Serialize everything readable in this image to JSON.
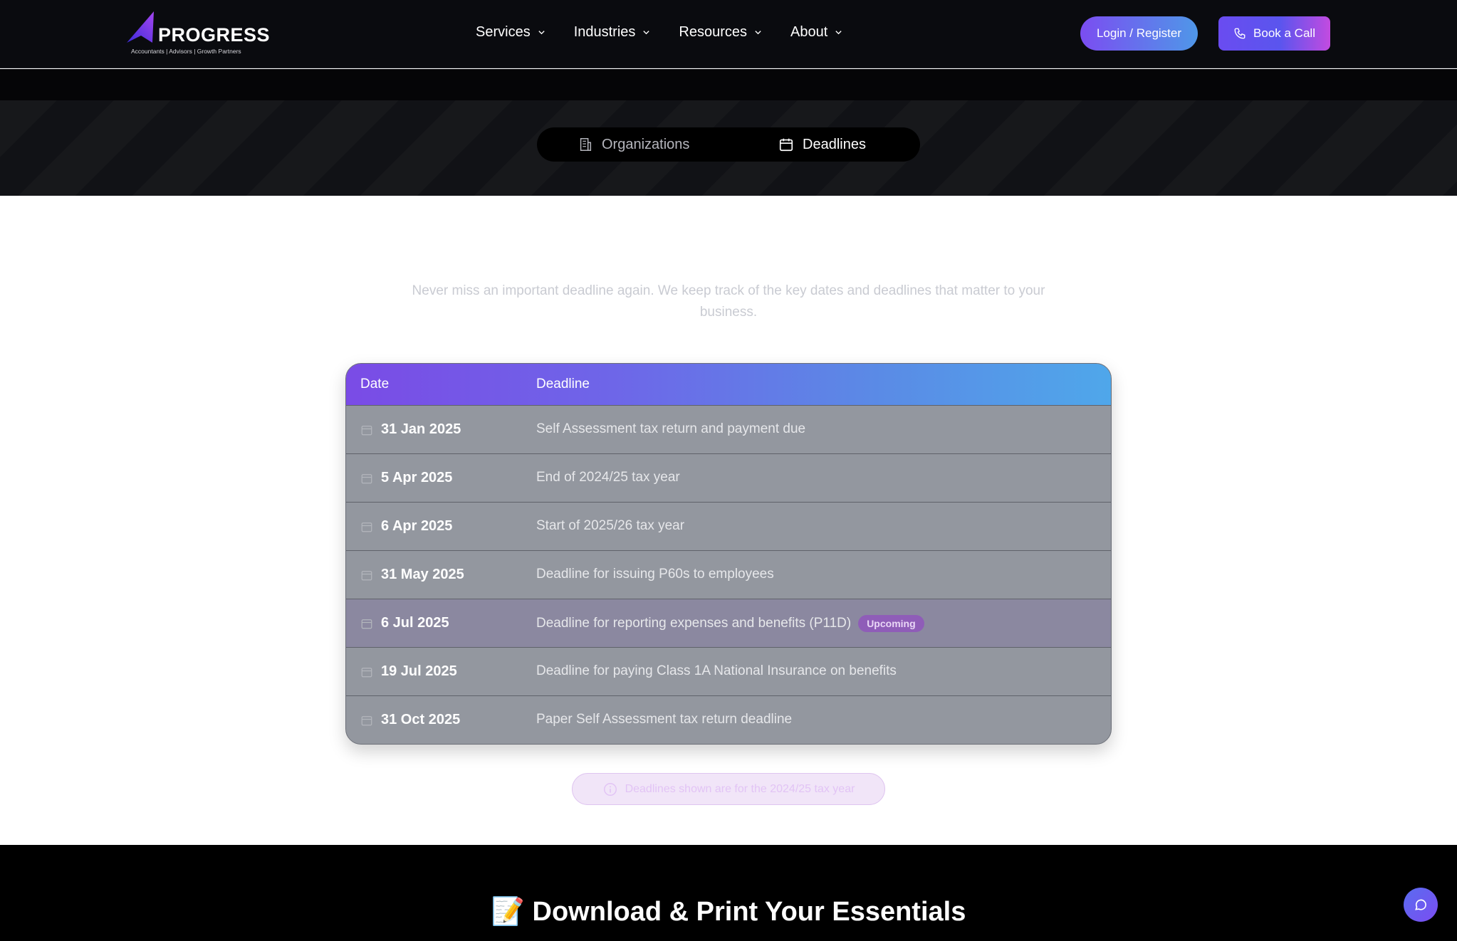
{
  "brand": {
    "name": "PROGRESS",
    "tagline": "Accountants | Advisors | Growth Partners",
    "icon": "triangle-logo-icon"
  },
  "nav": {
    "items": [
      {
        "label": "Services",
        "icon": "chevron-down-icon"
      },
      {
        "label": "Industries",
        "icon": "chevron-down-icon"
      },
      {
        "label": "Resources",
        "icon": "chevron-down-icon"
      },
      {
        "label": "About",
        "icon": "chevron-down-icon"
      }
    ],
    "login_label": "Login / Register",
    "call_label": "Book a Call",
    "call_icon": "phone-icon"
  },
  "tabs": [
    {
      "label": "Organizations",
      "icon": "building-icon",
      "active": false
    },
    {
      "label": "Deadlines",
      "icon": "calendar-icon",
      "active": true
    }
  ],
  "intro": "Never miss an important deadline again. We keep track of the key dates and deadlines that matter to your business.",
  "table": {
    "headers": {
      "date": "Date",
      "deadline": "Deadline"
    },
    "rows": [
      {
        "date": "31 Jan 2025",
        "deadline": "Self Assessment tax return and payment due",
        "badge": ""
      },
      {
        "date": "5 Apr 2025",
        "deadline": "End of 2024/25 tax year",
        "badge": ""
      },
      {
        "date": "6 Apr 2025",
        "deadline": "Start of 2025/26 tax year",
        "badge": ""
      },
      {
        "date": "31 May 2025",
        "deadline": "Deadline for issuing P60s to employees",
        "badge": ""
      },
      {
        "date": "6 Jul 2025",
        "deadline": "Deadline for reporting expenses and benefits (P11D)",
        "badge": "Upcoming"
      },
      {
        "date": "19 Jul 2025",
        "deadline": "Deadline for paying Class 1A National Insurance on benefits",
        "badge": ""
      },
      {
        "date": "31 Oct 2025",
        "deadline": "Paper Self Assessment tax return deadline",
        "badge": ""
      }
    ]
  },
  "note": {
    "text": "Deadlines shown are for the 2024/25 tax year",
    "icon": "info-icon"
  },
  "download": {
    "emoji": "📝",
    "title": "Download & Print Your Essentials"
  },
  "chat": {
    "icon": "chat-bubble-icon"
  },
  "colors": {
    "accent_purple": "#7b4df1",
    "accent_blue": "#4fa7ea",
    "badge": "#8f5db8"
  }
}
